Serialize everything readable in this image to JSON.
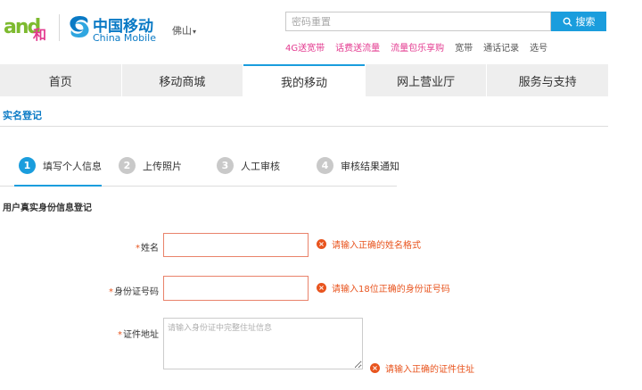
{
  "header": {
    "brand_and": "and",
    "brand_he": "和",
    "cm_name": "中国移动",
    "cm_en": "China Mobile",
    "city": "佛山",
    "city_caret": "▾",
    "search_placeholder": "密码重置",
    "search_button": "搜索",
    "quick_links": [
      {
        "label": "4G送宽带",
        "color": "#e3398f"
      },
      {
        "label": "话费送流量",
        "color": "#e3398f"
      },
      {
        "label": "流量包乐享购",
        "color": "#e3398f"
      },
      {
        "label": "宽带",
        "color": "#555555"
      },
      {
        "label": "通话记录",
        "color": "#555555"
      },
      {
        "label": "选号",
        "color": "#555555"
      }
    ]
  },
  "nav": {
    "items": [
      "首页",
      "移动商城",
      "我的移动",
      "网上营业厅",
      "服务与支持"
    ],
    "active_index": 2
  },
  "page": {
    "section_title": "实名登记",
    "form_title": "用户真实身份信息登记"
  },
  "steps": [
    {
      "num": "1",
      "label": "填写个人信息",
      "active": true
    },
    {
      "num": "2",
      "label": "上传照片",
      "active": false
    },
    {
      "num": "3",
      "label": "人工审核",
      "active": false
    },
    {
      "num": "4",
      "label": "审核结果通知",
      "active": false
    }
  ],
  "form": {
    "required_mark": "*",
    "name_label": "姓名",
    "name_value": "",
    "name_error": "请输入正确的姓名格式",
    "id_label": "身份证号码",
    "id_value": "",
    "id_error": "请输入18位正确的身份证号码",
    "addr_label": "证件地址",
    "addr_placeholder": "请输入身份证中完整住址信息",
    "addr_error": "请输入正确的证件住址",
    "error_icon": "×"
  },
  "colors": {
    "accent": "#1a9ddd",
    "brand_blue": "#0a7ac5",
    "error": "#e8541e",
    "pink": "#e3398f"
  }
}
